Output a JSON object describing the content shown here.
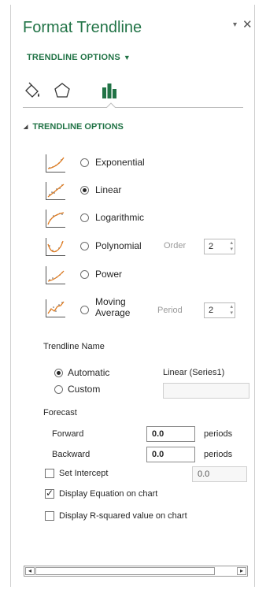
{
  "pane": {
    "title": "Format Trendline",
    "dropdown_icon": "▾",
    "close_icon": "✕",
    "options_menu_label": "TRENDLINE OPTIONS",
    "options_menu_caret": "▼"
  },
  "tabs": [
    {
      "icon": "fill-bucket-icon"
    },
    {
      "icon": "pentagon-effects-icon"
    },
    {
      "icon": "bar-chart-icon",
      "selected": true
    }
  ],
  "section": {
    "expand_icon": "◢",
    "title": "TRENDLINE OPTIONS"
  },
  "trend_types": {
    "exponential": {
      "label": "Exponential",
      "checked": false
    },
    "linear": {
      "label": "Linear",
      "checked": true
    },
    "logarithmic": {
      "label": "Logarithmic",
      "checked": false
    },
    "polynomial": {
      "label": "Polynomial",
      "checked": false
    },
    "power": {
      "label": "Power",
      "checked": false
    },
    "moving_average": {
      "label_line1": "Moving",
      "label_line2": "Average",
      "checked": false
    }
  },
  "order": {
    "label": "Order",
    "value": "2"
  },
  "period": {
    "label": "Period",
    "value": "2"
  },
  "trendline_name": {
    "heading": "Trendline Name",
    "automatic_label": "Automatic",
    "automatic_value": "Linear (Series1)",
    "custom_label": "Custom",
    "selected": "automatic"
  },
  "forecast": {
    "heading": "Forecast",
    "forward_label": "Forward",
    "forward_value": "0.0",
    "backward_label": "Backward",
    "backward_value": "0.0",
    "unit": "periods"
  },
  "set_intercept": {
    "label": "Set Intercept",
    "value": "0.0",
    "checked": false
  },
  "display_equation": {
    "label": "Display Equation on chart",
    "checked": true
  },
  "display_r_squared": {
    "label": "Display R-squared value on chart",
    "checked": false
  },
  "checkmark": "✓",
  "scrollbar": {
    "left_arrow": "◂",
    "right_arrow": "▸"
  },
  "colors": {
    "accent": "#217346",
    "text": "#262626",
    "border": "#707070"
  }
}
